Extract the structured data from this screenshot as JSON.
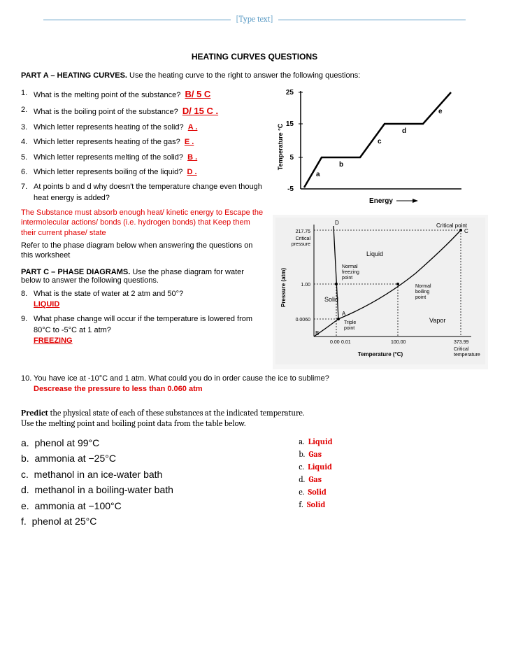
{
  "header_placeholder": "[Type text]",
  "title": "HEATING CURVES QUESTIONS",
  "partA": {
    "heading_prefix": "PART A – ",
    "heading": "HEATING CURVES.",
    "heading_suffix": "  Use the heating curve to the right to answer the following questions:",
    "q1": {
      "num": "1.",
      "text": "What is the melting point of the substance?",
      "ans": "B/ 5 C"
    },
    "q2": {
      "num": "2.",
      "text": "What is the boiling point of the substance?",
      "ans": "D/ 15 C ."
    },
    "q3": {
      "num": "3.",
      "text": "Which letter represents heating of the solid?",
      "ans": "A  ."
    },
    "q4": {
      "num": "4.",
      "text": "Which letter represents heating of the gas?",
      "ans": "E ."
    },
    "q5": {
      "num": "5.",
      "text": "Which letter represents melting of the solid?",
      "ans": "B ."
    },
    "q6": {
      "num": "6.",
      "text": "Which letter represents boiling of the liquid?",
      "ans": "D  ."
    },
    "q7": {
      "num": "7.",
      "text": "At points b and d why doesn't the temperature change even though heat energy is added?"
    },
    "a7": "The Substance must absorb enough heat/ kinetic energy to  Escape the intermolecular actions/ bonds (i.e. hydrogen bonds) that Keep them their current phase/ state"
  },
  "refer_text": "Refer to the phase diagram below when answering the questions on this worksheet",
  "partC": {
    "heading_prefix": "PART C – ",
    "heading": "PHASE DIAGRAMS.",
    "heading_suffix": "  Use the phase diagram for water below to answer the following questions.",
    "q8": {
      "num": "8.",
      "text": "What is the state of water at 2 atm and 50°?",
      "ans": "LIQUID"
    },
    "q9": {
      "num": "9.",
      "text": "What phase change will occur if the temperature is lowered from 80°C to -5°C at 1 atm?",
      "ans": "FREEZING"
    },
    "q10": {
      "num": "10.",
      "text": "You have ice at -10°C and 1 atm.  What could you do in order cause the ice to sublime?",
      "ans": "Descrease the pressure to less than 0.060 atm"
    }
  },
  "predict": {
    "heading_strong": "Predict",
    "heading_rest": " the physical state of each of these substances at the indicated temperature.",
    "heading_line2": "Use the melting point and boiling point data from the table below.",
    "items": {
      "a": {
        "label": "a.",
        "text": "phenol at 99°C"
      },
      "b": {
        "label": "b.",
        "text": "ammonia at −25°C"
      },
      "c": {
        "label": "c.",
        "text": "methanol in an ice-water bath"
      },
      "d": {
        "label": "d.",
        "text": "methanol in a boiling-water bath"
      },
      "e": {
        "label": "e.",
        "text": "ammonia at −100°C"
      },
      "f": {
        "label": "f.",
        "text": "phenol at 25°C"
      }
    },
    "answers": {
      "a": {
        "label": "a.",
        "ans": "Liquid"
      },
      "b": {
        "label": "b.",
        "ans": "Gas"
      },
      "c": {
        "label": "c.",
        "ans": "Liquid"
      },
      "d": {
        "label": "d.",
        "ans": "Gas"
      },
      "e": {
        "label": "e.",
        "ans": "Solid"
      },
      "f": {
        "label": "f.",
        "ans": "Solid"
      }
    }
  },
  "chart_data": [
    {
      "type": "line",
      "title": "Heating Curve",
      "xlabel": "Energy →",
      "ylabel": "Temperature °C",
      "ylim": [
        -5,
        25
      ],
      "yticks": [
        -5,
        5,
        15,
        25
      ],
      "segments": [
        {
          "name": "a",
          "from": {
            "energy": 0,
            "temp": -5
          },
          "to": {
            "energy": 1,
            "temp": 5
          }
        },
        {
          "name": "b",
          "from": {
            "energy": 1,
            "temp": 5
          },
          "to": {
            "energy": 2.5,
            "temp": 5
          }
        },
        {
          "name": "c",
          "from": {
            "energy": 2.5,
            "temp": 5
          },
          "to": {
            "energy": 3.5,
            "temp": 15
          }
        },
        {
          "name": "d",
          "from": {
            "energy": 3.5,
            "temp": 15
          },
          "to": {
            "energy": 5.5,
            "temp": 15
          }
        },
        {
          "name": "e",
          "from": {
            "energy": 5.5,
            "temp": 15
          },
          "to": {
            "energy": 6.5,
            "temp": 25
          }
        }
      ]
    },
    {
      "type": "phase-diagram",
      "xlabel": "Temperature (°C)",
      "ylabel": "Pressure (atm)",
      "regions": [
        "Solid",
        "Liquid",
        "Vapor"
      ],
      "points": {
        "triple_point": {
          "label": "Triple point",
          "letter": "A",
          "temp": 0.01,
          "pressure": 0.006
        },
        "normal_freezing_point": {
          "label": "Normal freezing point",
          "temp": 0.0,
          "pressure": 1.0
        },
        "normal_boiling_point": {
          "label": "Normal boiling point",
          "temp": 100.0,
          "pressure": 1.0
        },
        "critical_point": {
          "label": "Critical point",
          "letter": "C",
          "temp": 373.99,
          "pressure": 217.75
        },
        "D": {
          "letter": "D",
          "region": "Solid-Liquid boundary top"
        },
        "B": {
          "letter": "B",
          "region": "sublimation curve start"
        }
      },
      "axis_labels": {
        "y": [
          "0.0060",
          "1.00",
          "217.75",
          "Critical pressure"
        ],
        "x": [
          "0.00",
          "0.01",
          "100.00",
          "373.99",
          "Critical temperature"
        ]
      }
    }
  ]
}
